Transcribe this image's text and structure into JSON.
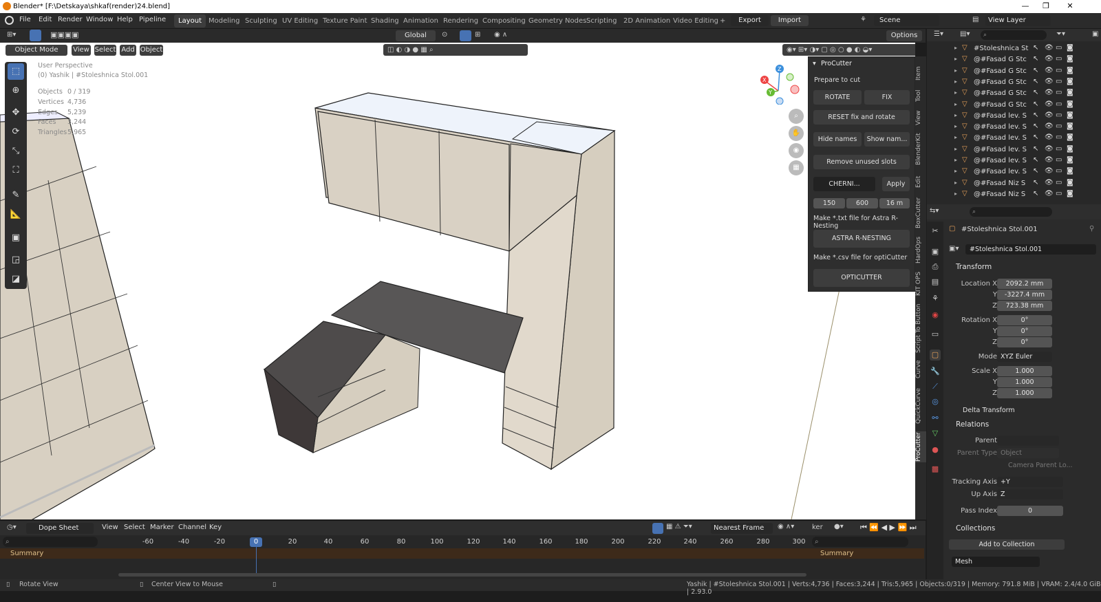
{
  "window": {
    "title": "Blender* [F:\\Detskaya\\shkaf(render)24.blend]"
  },
  "menu": [
    "File",
    "Edit",
    "Render",
    "Window",
    "Help",
    "Pipeline"
  ],
  "workspaces": [
    "Layout",
    "Modeling",
    "Sculpting",
    "UV Editing",
    "Texture Paint",
    "Shading",
    "Animation",
    "Rendering",
    "Compositing",
    "Geometry Nodes",
    "Scripting",
    "2D Animation",
    "Video Editing"
  ],
  "topright": {
    "export": "Export",
    "import": "Import",
    "scene": "Scene",
    "view_layer": "View Layer"
  },
  "viewport_header": {
    "mode": "Object Mode",
    "view": "View",
    "select": "Select",
    "add": "Add",
    "object": "Object",
    "orientation": "Global",
    "options": "Options"
  },
  "overlay": {
    "line1": "User Perspective",
    "line2": "(0) Yashik | #Stoleshnica Stol.001",
    "stats": [
      [
        "Objects",
        "0 / 319"
      ],
      [
        "Vertices",
        "4,736"
      ],
      [
        "Edges",
        "5,239"
      ],
      [
        "Faces",
        "3,244"
      ],
      [
        "Triangles",
        "5,965"
      ]
    ]
  },
  "gizmo": {
    "x": "X",
    "y": "Y",
    "z": "Z"
  },
  "side_tabs": [
    "Item",
    "Tool",
    "View",
    "BlenderKit",
    "Edit",
    "BoxCutter",
    "HardOps",
    "KIT OPS",
    "Script To Button",
    "Curve",
    "QuickCurve",
    "ProCutter"
  ],
  "procutter": {
    "title": "ProCutter",
    "prepare": "Prepare to cut",
    "rotate": "ROTATE",
    "fix": "FIX",
    "reset": "RESET fix and rotate",
    "hide_names": "Hide names",
    "show_names": "Show nam...",
    "remove_slots": "Remove unused slots",
    "material": "CHERNI...",
    "apply": "Apply",
    "v1": "150",
    "v2": "600",
    "v3": "16 m",
    "txt_label": "Make *.txt file for Astra R-Nesting",
    "astra": "ASTRA R-NESTING",
    "csv_label": "Make *.csv file for optiCutter",
    "opticutter": "OPTICUTTER"
  },
  "outliner": {
    "items": [
      "#Stoleshnica St",
      "@#Fasad G Stc",
      "@#Fasad G Stc",
      "@#Fasad G Stc",
      "@#Fasad G Stc",
      "@#Fasad G Stc",
      "@#Fasad lev. S",
      "@#Fasad lev. S",
      "@#Fasad lev. S",
      "@#Fasad lev. S",
      "@#Fasad lev. S",
      "@#Fasad lev. S",
      "@#Fasad Niz S",
      "@#Fasad Niz S"
    ]
  },
  "properties": {
    "object_name": "#Stoleshnica Stol.001",
    "data_name": "#Stoleshnica Stol.001",
    "transform": "Transform",
    "location_x_label": "Location X",
    "y_label": "Y",
    "z_label": "Z",
    "loc_x": "2092.2 mm",
    "loc_y": "-3227.4 mm",
    "loc_z": "723.38 mm",
    "rotation_x_label": "Rotation X",
    "rot_x": "0°",
    "rot_y": "0°",
    "rot_z": "0°",
    "mode_label": "Mode",
    "mode": "XYZ Euler",
    "scale_x_label": "Scale X",
    "sc_x": "1.000",
    "sc_y": "1.000",
    "sc_z": "1.000",
    "delta": "Delta Transform",
    "relations": "Relations",
    "parent_label": "Parent",
    "parent_type_label": "Parent Type",
    "parent_type": "Object",
    "camera_parent": "Camera Parent Lo...",
    "tracking_label": "Tracking Axis",
    "tracking": "+Y",
    "up_label": "Up Axis",
    "up": "Z",
    "pass_label": "Pass Index",
    "pass": "0",
    "collections": "Collections",
    "add_collection": "Add to Collection",
    "collection_name": "Mesh"
  },
  "dopesheet": {
    "mode": "Dope Sheet",
    "view": "View",
    "select": "Select",
    "marker": "Marker",
    "channel": "Channel",
    "key": "Key",
    "frame_mode": "Nearest Frame",
    "current": "0",
    "summary": "Summary",
    "summary2": "Summary",
    "ticks": [
      "-60",
      "-40",
      "-20",
      "20",
      "40",
      "60",
      "80",
      "100",
      "120",
      "140",
      "160",
      "180",
      "200",
      "220",
      "240",
      "260",
      "280",
      "300"
    ],
    "ker": "ker"
  },
  "status": {
    "left": "Rotate View",
    "mid": "Center View to Mouse",
    "right": "Yashik | #Stoleshnica Stol.001 | Verts:4,736 | Faces:3,244 | Tris:5,965 | Objects:0/319 | Memory: 791.8 MiB | VRAM: 2.4/4.0 GiB | 2.93.0"
  },
  "colors": {
    "accent": "#4772b3",
    "orange": "#e87d0d",
    "active_ws": "#3d3d3d"
  }
}
